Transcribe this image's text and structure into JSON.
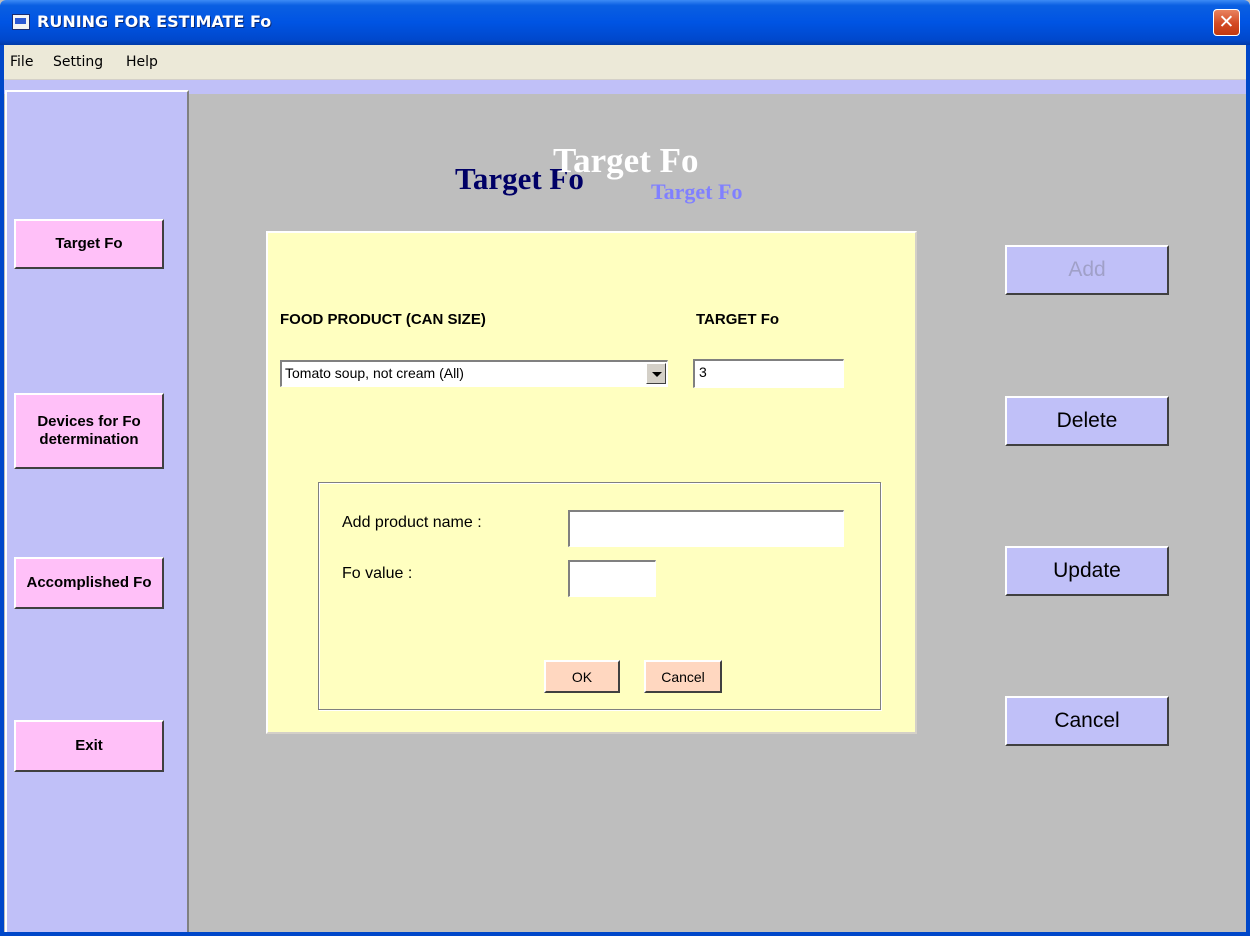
{
  "window": {
    "title": "RUNING FOR ESTIMATE Fo",
    "close_glyph": "✕"
  },
  "menu": {
    "items": [
      "File",
      "Setting",
      "Help"
    ]
  },
  "sidebar": {
    "buttons": [
      "Target Fo",
      "Devices for Fo determination",
      "Accomplished Fo",
      "Exit"
    ]
  },
  "heading": {
    "text": "Target Fo",
    "colors": [
      "#000066",
      "#ffffff",
      "#8080ff"
    ]
  },
  "panel": {
    "food_label": "FOOD PRODUCT (CAN SIZE)",
    "target_label": "TARGET Fo",
    "selected_product": "Tomato soup, not cream (All)",
    "target_value": "3",
    "add_product_label": "Add product name  :",
    "fo_value_label": "Fo value :",
    "product_name_value": "",
    "fo_value_value": "",
    "ok_label": "OK",
    "cancel_label": "Cancel"
  },
  "actions": {
    "add": "Add",
    "delete": "Delete",
    "update": "Update",
    "cancel": "Cancel",
    "add_enabled": false
  },
  "colors": {
    "sidebar": "#c0c0f8",
    "side_button": "#ffc0f8",
    "panel": "#ffffc0",
    "ok_button": "#ffd7c0",
    "cancel_button": "#ffd7c0",
    "background": "#bebebe"
  }
}
